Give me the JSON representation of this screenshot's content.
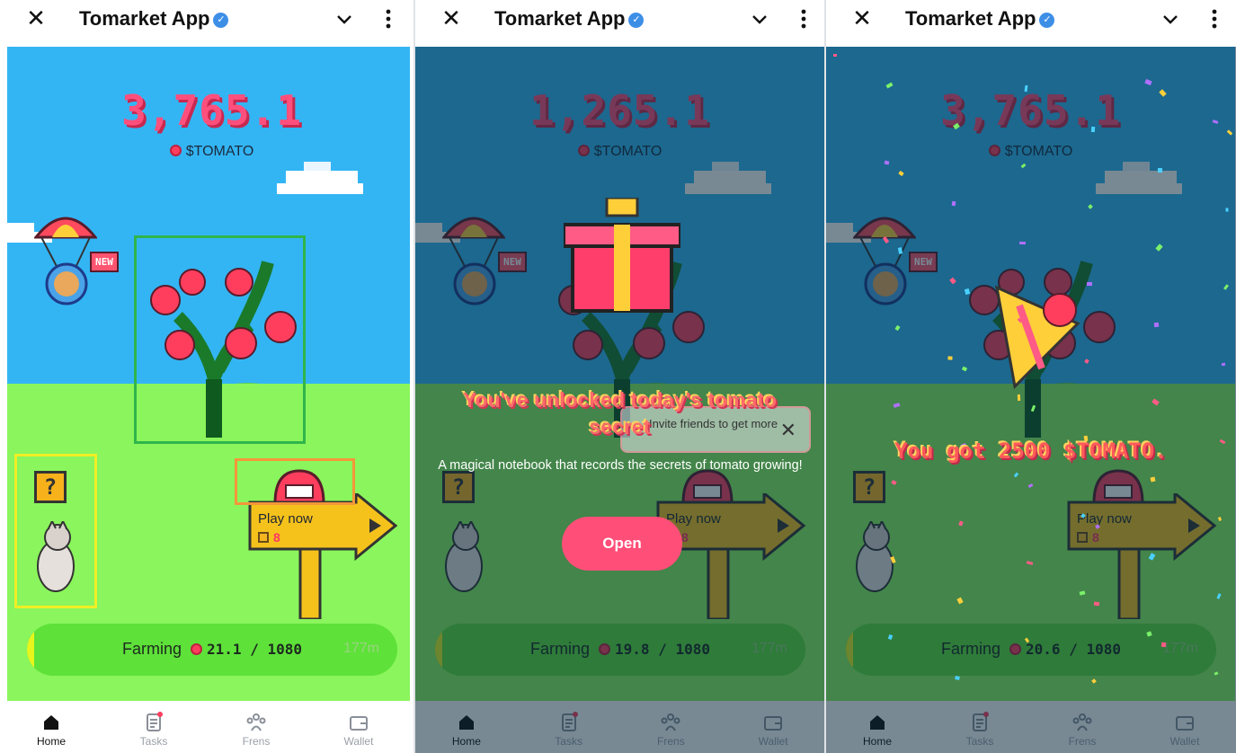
{
  "panels": [
    {
      "header": {
        "title": "Tomarket App"
      },
      "balance": "3,765.1",
      "token": "$TOMATO",
      "new_tag": "NEW",
      "mystery_label": "?",
      "sign": {
        "label": "Play now",
        "count": "8"
      },
      "farm": {
        "label": "Farming",
        "amount": "21.1 / 1080",
        "time": "177m",
        "progress": 0.02
      },
      "nav": [
        {
          "label": "Home",
          "icon": "home-icon",
          "active": true
        },
        {
          "label": "Tasks",
          "icon": "tasks-icon"
        },
        {
          "label": "Frens",
          "icon": "frens-icon"
        },
        {
          "label": "Wallet",
          "icon": "wallet-icon"
        }
      ]
    },
    {
      "header": {
        "title": "Tomarket App"
      },
      "balance": "1,265.1",
      "token": "$TOMATO",
      "new_tag": "NEW",
      "mystery_label": "?",
      "sign": {
        "label": "Play now",
        "count": "8"
      },
      "farm": {
        "label": "Farming",
        "amount": "19.8 / 1080",
        "time": "177m",
        "progress": 0.02
      },
      "modal": {
        "title": "You've unlocked today's tomato secret",
        "description": "A magical notebook that records the secrets of tomato growing!",
        "button": "Open"
      },
      "toast": {
        "text": "Invite friends to get more"
      },
      "nav": [
        {
          "label": "Home",
          "icon": "home-icon",
          "active": true
        },
        {
          "label": "Tasks",
          "icon": "tasks-icon"
        },
        {
          "label": "Frens",
          "icon": "frens-icon"
        },
        {
          "label": "Wallet",
          "icon": "wallet-icon"
        }
      ]
    },
    {
      "header": {
        "title": "Tomarket App"
      },
      "balance": "3,765.1",
      "token": "$TOMATO",
      "new_tag": "NEW",
      "mystery_label": "?",
      "sign": {
        "label": "Play now",
        "count": "8"
      },
      "farm": {
        "label": "Farming",
        "amount": "20.6 / 1080",
        "time": "177m",
        "progress": 0.02
      },
      "reward": "You got 2500 $TOMATO.",
      "nav": [
        {
          "label": "Home",
          "icon": "home-icon",
          "active": true
        },
        {
          "label": "Tasks",
          "icon": "tasks-icon"
        },
        {
          "label": "Frens",
          "icon": "frens-icon"
        },
        {
          "label": "Wallet",
          "icon": "wallet-icon"
        }
      ]
    }
  ],
  "colors": {
    "accent": "#ff4f7c",
    "sky": "#33b5f4",
    "grass": "#8af55c",
    "farm_bar": "#5ee139",
    "verified": "#3d8fe6"
  }
}
